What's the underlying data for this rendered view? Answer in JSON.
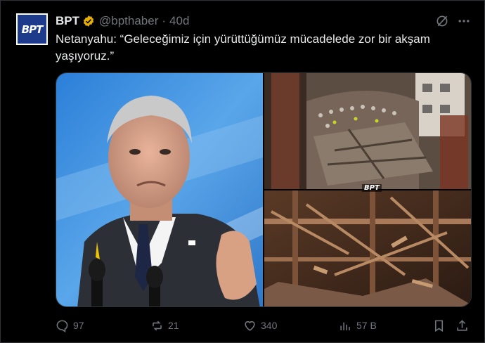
{
  "tweet": {
    "author": {
      "name": "BPT",
      "handle": "@bpthaber",
      "avatar_text": "BPT",
      "verified_color": "#e8b000"
    },
    "separator": "·",
    "time": "40d",
    "text": "Netanyahu: “Geleceğimiz için yürüttüğümüz mücadelede zor bir akşam yaşıyoruz.”",
    "media": {
      "watermark": "BPT"
    },
    "actions": {
      "replies": "97",
      "reposts": "21",
      "likes": "340",
      "views": "57 B"
    }
  },
  "icons": [
    "grok-icon",
    "more-icon",
    "reply-icon",
    "repost-icon",
    "like-icon",
    "views-icon",
    "bookmark-icon",
    "share-icon"
  ],
  "colors": {
    "background": "#000000",
    "text": "#e7e9ea",
    "muted": "#71767b",
    "border": "#2f3336"
  }
}
